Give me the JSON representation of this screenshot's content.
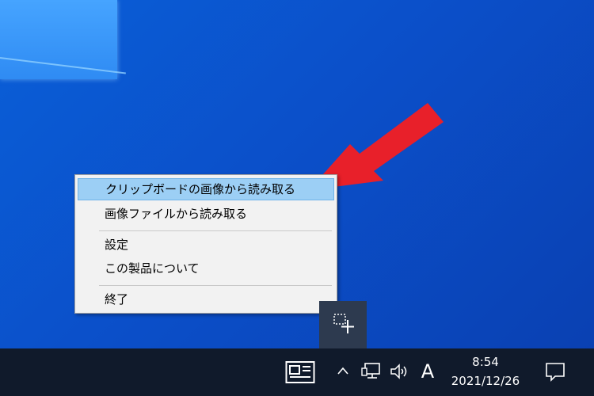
{
  "context_menu": {
    "items": [
      {
        "label": "クリップボードの画像から読み取る",
        "highlighted": true
      },
      {
        "label": "画像ファイルから読み取る"
      },
      {
        "label": "設定"
      },
      {
        "label": "この製品について"
      },
      {
        "label": "終了"
      }
    ]
  },
  "tray_popup": {
    "icon": "screen-snip-icon"
  },
  "taskbar": {
    "ime_indicator": "A",
    "clock": {
      "time": "8:54",
      "date": "2021/12/26"
    },
    "icons": [
      "news-icon",
      "chevron-up-icon",
      "network-icon",
      "volume-icon",
      "notification-icon"
    ]
  },
  "colors": {
    "menu_highlight": "#9ccff5",
    "arrow": "#e8202a",
    "taskbar": "#101a2b"
  }
}
